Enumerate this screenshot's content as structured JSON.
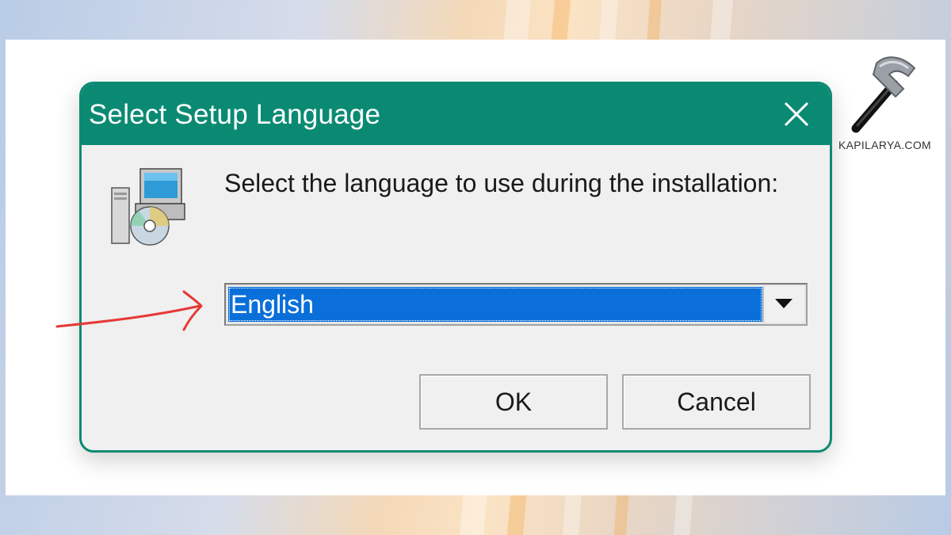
{
  "dialog": {
    "title": "Select Setup Language",
    "prompt": "Select the language to use during the installation:",
    "language_select": {
      "selected": "English"
    },
    "ok_label": "OK",
    "cancel_label": "Cancel"
  },
  "watermark": {
    "site": "KAPILARYA.COM"
  },
  "icons": {
    "close": "close-icon",
    "setup": "setup-computer-cd-icon",
    "dropdown": "chevron-down-icon",
    "annotation": "red-arrow",
    "logo": "hammer-logo"
  },
  "colors": {
    "titlebar": "#0b8a73",
    "selection": "#0a6fd9",
    "annotation_arrow": "#e53935",
    "dialog_body": "#f0f0f0"
  }
}
